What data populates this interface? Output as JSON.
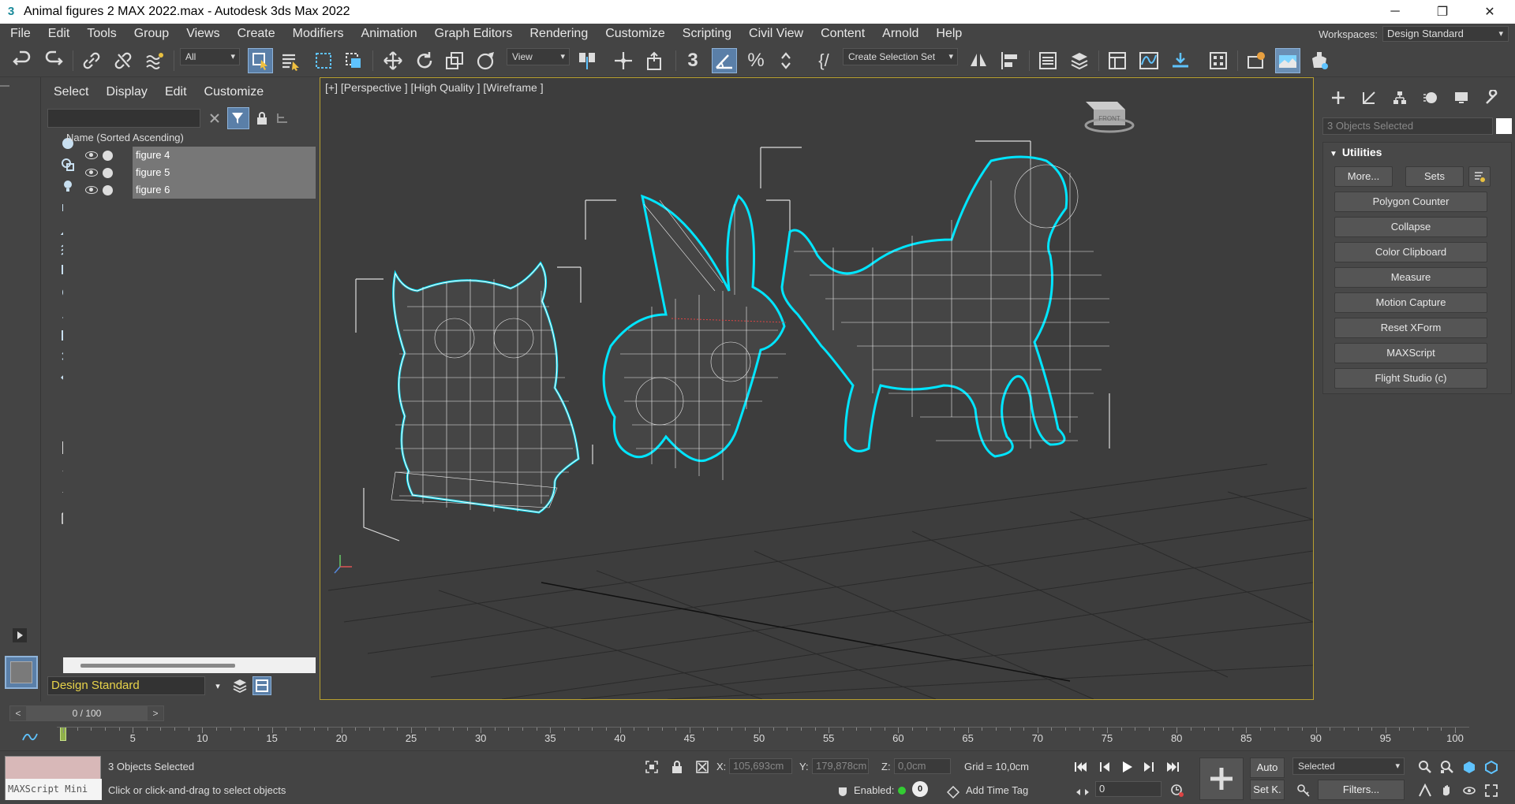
{
  "window": {
    "title": "Animal figures 2 MAX 2022.max - Autodesk 3ds Max 2022",
    "minimize": "─",
    "restore": "❐",
    "close": "✕"
  },
  "menu": [
    "File",
    "Edit",
    "Tools",
    "Group",
    "Views",
    "Create",
    "Modifiers",
    "Animation",
    "Graph Editors",
    "Rendering",
    "Customize",
    "Scripting",
    "Civil View",
    "Content",
    "Arnold",
    "Help"
  ],
  "workspaces": {
    "label": "Workspaces:",
    "value": "Design Standard"
  },
  "toolbar": {
    "filter": "All",
    "ref_coord": "View",
    "selection_set": "Create Selection Set",
    "snap_label": "3"
  },
  "scene_explorer": {
    "tabs": [
      "Select",
      "Display",
      "Edit",
      "Customize"
    ],
    "column_header": "Name (Sorted Ascending)",
    "items": [
      {
        "name": "figure 4"
      },
      {
        "name": "figure 5"
      },
      {
        "name": "figure 6"
      }
    ],
    "workspace": "Design Standard"
  },
  "viewport": {
    "label": "[+] [Perspective ] [High Quality ] [Wireframe ]",
    "viewcube": "FRONT"
  },
  "command_panel": {
    "selection": "3 Objects Selected",
    "rollout": "Utilities",
    "buttons": {
      "more": "More...",
      "sets": "Sets"
    },
    "utilities": [
      "Polygon Counter",
      "Collapse",
      "Color Clipboard",
      "Measure",
      "Motion Capture",
      "Reset XForm",
      "MAXScript",
      "Flight Studio (c)"
    ]
  },
  "timeline": {
    "position": "0 / 100",
    "prev": "<",
    "next": ">",
    "ticks": [
      "5",
      "10",
      "15",
      "20",
      "25",
      "30",
      "35",
      "40",
      "45",
      "50",
      "55",
      "60",
      "65",
      "70",
      "75",
      "80",
      "85",
      "90",
      "95",
      "100"
    ]
  },
  "status": {
    "maxscript": "MAXScript Mini",
    "selected": "3 Objects Selected",
    "prompt": "Click or click-and-drag to select objects",
    "x_label": "X:",
    "x": "105,693cm",
    "y_label": "Y:",
    "y": "179,878cm",
    "z_label": "Z:",
    "z": "0,0cm",
    "grid": "Grid = 10,0cm",
    "enabled": "Enabled:",
    "add_time_tag": "Add Time Tag",
    "auto": "Auto",
    "set_key": "Set K.",
    "key_filter": "Selected",
    "filters": "Filters...",
    "frame": "0"
  },
  "colors": {
    "accent": "#5a7fa8",
    "selection": "#00e5ff",
    "viewport_border": "#b8a030",
    "workspace_text": "#e8d34a"
  }
}
